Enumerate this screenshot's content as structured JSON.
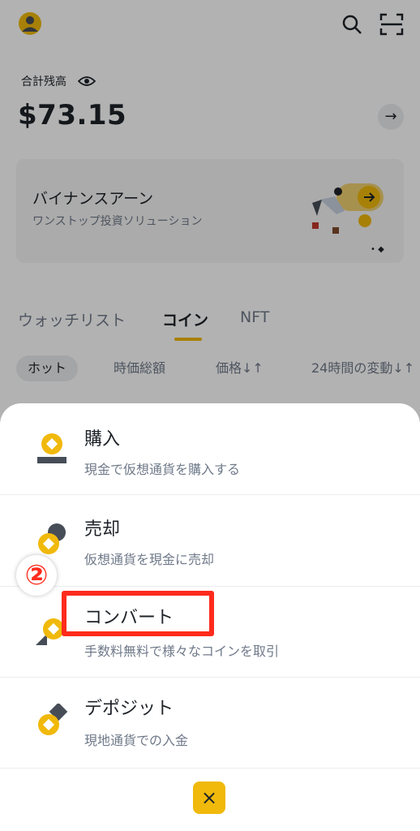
{
  "header": {
    "balance_label": "合計残高",
    "balance_value": "$73.15"
  },
  "earn_card": {
    "title": "バイナンスアーン",
    "subtitle": "ワンストップ投資ソリューション"
  },
  "tabs": [
    {
      "label": "ウォッチリスト"
    },
    {
      "label": "コイン"
    },
    {
      "label": "NFT"
    }
  ],
  "chips": [
    {
      "label": "ホット"
    },
    {
      "label": "時価総額"
    },
    {
      "label": "価格↓↑"
    },
    {
      "label": "24時間の変動↓↑"
    }
  ],
  "sheet": {
    "items": [
      {
        "title": "購入",
        "desc": "現金で仮想通貨を購入する"
      },
      {
        "title": "売却",
        "desc": "仮想通貨を現金に売却"
      },
      {
        "title": "コンバート",
        "desc": "手数料無料で様々なコインを取引"
      },
      {
        "title": "デポジット",
        "desc": "現地通貨での入金"
      }
    ],
    "close_icon": "×"
  },
  "annotation": {
    "step_badge": "②"
  },
  "colors": {
    "accent": "#f0b90b",
    "highlight": "#ff2b1c",
    "text": "#1e2329",
    "muted": "#707a8a"
  }
}
